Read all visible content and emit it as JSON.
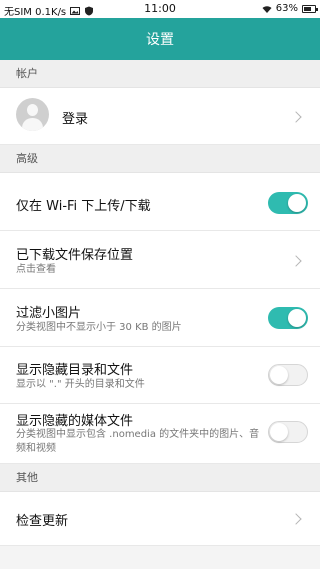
{
  "status_bar": {
    "carrier": "无SIM 0.1K/s",
    "time": "11:00",
    "battery": "63%",
    "icons": [
      "image-icon",
      "shield-icon",
      "wifi-icon",
      "battery-icon"
    ]
  },
  "app_bar": {
    "title": "设置",
    "color": "#24a39c"
  },
  "sections": {
    "account": "帐户",
    "advanced": "高级",
    "other": "其他"
  },
  "account": {
    "login_label": "登录"
  },
  "settings": {
    "wifi_only": {
      "title": "仅在 Wi-Fi 下上传/下载",
      "enabled": true
    },
    "download_location": {
      "title": "已下载文件保存位置",
      "subtitle": "点击查看"
    },
    "filter_small_images": {
      "title": "过滤小图片",
      "subtitle": "分类视图中不显示小于 30 KB 的图片",
      "enabled": true
    },
    "show_hidden_dirs": {
      "title": "显示隐藏目录和文件",
      "subtitle": "显示以 \".\" 开头的目录和文件",
      "enabled": false
    },
    "show_hidden_media": {
      "title": "显示隐藏的媒体文件",
      "subtitle": "分类视图中显示包含 .nomedia 的文件夹中的图片、音频和视频",
      "enabled": false
    }
  },
  "other": {
    "check_update": "检查更新"
  },
  "colors": {
    "toggle_on": "#2fbbb0",
    "toggle_off": "#f2f2f2"
  }
}
